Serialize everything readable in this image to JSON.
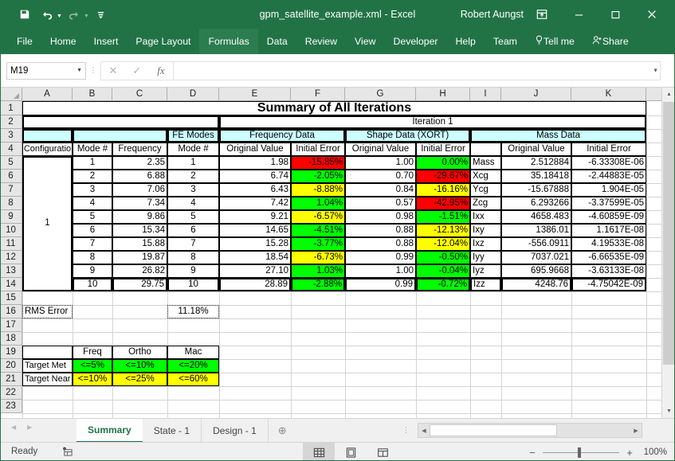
{
  "window": {
    "title": "gpm_satellite_example.xml  -  Excel",
    "user": "Robert Aungst",
    "qat": [
      {
        "name": "save-icon",
        "glyph": "ὋE"
      },
      {
        "name": "undo-icon",
        "glyph": "↶"
      },
      {
        "name": "redo-icon",
        "glyph": "↷"
      },
      {
        "name": "customize-quick-access-toolbar-icon",
        "glyph": "≡"
      }
    ],
    "controls": {
      "ribbon_display": "ribbon-display-options",
      "minimize": "minimize",
      "maximize": "maximize",
      "close": "close"
    }
  },
  "ribbon": {
    "tabs": [
      "File",
      "Home",
      "Insert",
      "Page Layout",
      "Formulas",
      "Data",
      "Review",
      "View",
      "Developer",
      "Help",
      "Team"
    ],
    "active_tab": "Formulas",
    "tell_me": "Tell me",
    "share": "Share"
  },
  "formula_bar": {
    "name_box": "M19",
    "formula": "",
    "cancel_label": "✕",
    "enter_label": "✓",
    "function_label": "fx"
  },
  "grid": {
    "columns": [
      "A",
      "B",
      "C",
      "D",
      "E",
      "F",
      "G",
      "H",
      "I",
      "J",
      "K"
    ],
    "rows": [
      "1",
      "2",
      "3",
      "4",
      "5",
      "6",
      "7",
      "8",
      "9",
      "10",
      "11",
      "12",
      "13",
      "14",
      "15",
      "16",
      "17",
      "18",
      "19",
      "20",
      "21",
      "22",
      "23"
    ],
    "selected_cell": "M19",
    "title": "Summary of All Iterations",
    "iteration_label": "Iteration 1",
    "group_headers": {
      "fe_modes": "FE Modes",
      "frequency_data": "Frequency Data",
      "shape_data": "Shape Data (XORT)",
      "mass_data": "Mass Data"
    },
    "column_headers": {
      "configuration": "Configuratio",
      "mode_num": "Mode #",
      "frequency": "Frequency",
      "fe_mode_num": "Mode #",
      "freq_original": "Original Value",
      "freq_error": "Initial Error",
      "shape_original": "Original Value",
      "shape_error": "Initial Error",
      "mass_blank": "",
      "mass_original": "Original Value",
      "mass_error": "Initial Error"
    },
    "configuration_value": "1",
    "rows_data": [
      {
        "mode": "1",
        "frequency": "2.35",
        "fe_mode": "1",
        "freq_orig": "1.98",
        "freq_err": "-15.85%",
        "freq_err_color": "red",
        "shape_orig": "1.00",
        "shape_err": "0.00%",
        "shape_err_color": "green",
        "mass_label": "Mass",
        "mass_orig": "2.512884",
        "mass_err": "-6.33308E-06"
      },
      {
        "mode": "2",
        "frequency": "6.88",
        "fe_mode": "2",
        "freq_orig": "6.74",
        "freq_err": "-2.05%",
        "freq_err_color": "green",
        "shape_orig": "0.70",
        "shape_err": "-29.67%",
        "shape_err_color": "red",
        "mass_label": "Xcg",
        "mass_orig": "35.18418",
        "mass_err": "-2.44883E-05"
      },
      {
        "mode": "3",
        "frequency": "7.06",
        "fe_mode": "3",
        "freq_orig": "6.43",
        "freq_err": "-8.88%",
        "freq_err_color": "yellow",
        "shape_orig": "0.84",
        "shape_err": "-16.16%",
        "shape_err_color": "yellow",
        "mass_label": "Ycg",
        "mass_orig": "-15.67888",
        "mass_err": "1.904E-05"
      },
      {
        "mode": "4",
        "frequency": "7.34",
        "fe_mode": "4",
        "freq_orig": "7.42",
        "freq_err": "1.04%",
        "freq_err_color": "green",
        "shape_orig": "0.57",
        "shape_err": "-42.95%",
        "shape_err_color": "red",
        "mass_label": "Zcg",
        "mass_orig": "6.293266",
        "mass_err": "-3.37599E-05"
      },
      {
        "mode": "5",
        "frequency": "9.86",
        "fe_mode": "5",
        "freq_orig": "9.21",
        "freq_err": "-6.57%",
        "freq_err_color": "yellow",
        "shape_orig": "0.98",
        "shape_err": "-1.51%",
        "shape_err_color": "green",
        "mass_label": "Ixx",
        "mass_orig": "4658.483",
        "mass_err": "-4.60859E-09"
      },
      {
        "mode": "6",
        "frequency": "15.34",
        "fe_mode": "6",
        "freq_orig": "14.65",
        "freq_err": "-4.51%",
        "freq_err_color": "green",
        "shape_orig": "0.88",
        "shape_err": "-12.13%",
        "shape_err_color": "yellow",
        "mass_label": "Ixy",
        "mass_orig": "1386.01",
        "mass_err": "1.1617E-08"
      },
      {
        "mode": "7",
        "frequency": "15.88",
        "fe_mode": "7",
        "freq_orig": "15.28",
        "freq_err": "-3.77%",
        "freq_err_color": "green",
        "shape_orig": "0.88",
        "shape_err": "-12.04%",
        "shape_err_color": "yellow",
        "mass_label": "Ixz",
        "mass_orig": "-556.0911",
        "mass_err": "4.19533E-08"
      },
      {
        "mode": "8",
        "frequency": "19.87",
        "fe_mode": "8",
        "freq_orig": "18.54",
        "freq_err": "-6.73%",
        "freq_err_color": "yellow",
        "shape_orig": "0.99",
        "shape_err": "-0.50%",
        "shape_err_color": "green",
        "mass_label": "Iyy",
        "mass_orig": "7037.021",
        "mass_err": "-6.66535E-09"
      },
      {
        "mode": "9",
        "frequency": "26.82",
        "fe_mode": "9",
        "freq_orig": "27.10",
        "freq_err": "1.03%",
        "freq_err_color": "green",
        "shape_orig": "1.00",
        "shape_err": "-0.04%",
        "shape_err_color": "green",
        "mass_label": "Iyz",
        "mass_orig": "695.9668",
        "mass_err": "-3.63133E-08"
      },
      {
        "mode": "10",
        "frequency": "29.75",
        "fe_mode": "10",
        "freq_orig": "28.89",
        "freq_err": "-2.88%",
        "freq_err_color": "green",
        "shape_orig": "0.99",
        "shape_err": "-0.72%",
        "shape_err_color": "green",
        "mass_label": "Izz",
        "mass_orig": "4248.76",
        "mass_err": "-4.75042E-09"
      }
    ],
    "rms_error_label": "RMS Error",
    "rms_error_value": "11.18%",
    "legend": {
      "headers": [
        "Freq",
        "Ortho",
        "Mac"
      ],
      "rows": [
        {
          "label": "Target Met",
          "values": [
            "<=5%",
            "<=10%",
            "<=20%"
          ],
          "color": "green"
        },
        {
          "label": "Target Near",
          "values": [
            "<=10%",
            "<=25%",
            "<=60%"
          ],
          "color": "yellow"
        }
      ]
    }
  },
  "sheet_tabs": {
    "tabs": [
      "Summary",
      "State - 1",
      "Design - 1"
    ],
    "active": "Summary",
    "add_label": "⊕"
  },
  "status_bar": {
    "status": "Ready",
    "recording_icon": "macro-record-icon",
    "views": [
      "normal-view-icon",
      "page-layout-view-icon",
      "page-break-preview-icon"
    ],
    "active_view": "normal-view-icon",
    "zoom": "100%",
    "zoom_out": "−",
    "zoom_in": "+"
  },
  "colors": {
    "brand_green": "#217346",
    "header_cyan": "#CCFFFF",
    "error_red": "#FF0000",
    "error_green": "#00FF00",
    "error_yellow": "#FFFF00"
  }
}
